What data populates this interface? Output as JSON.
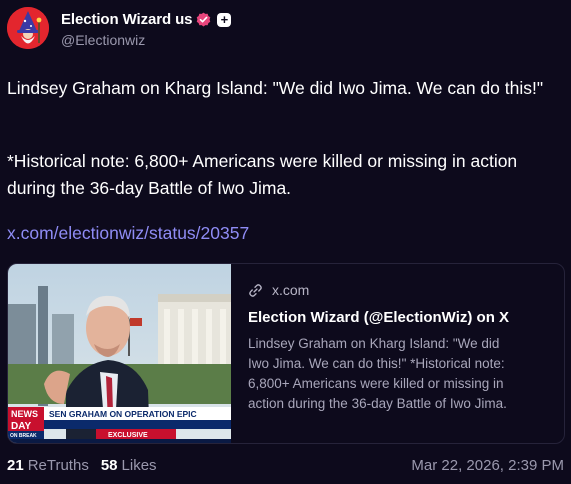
{
  "author": {
    "display_name": "Election Wizard us",
    "handle": "@Electionwiz",
    "follow_symbol": "+",
    "verified_color": "#e8457c",
    "avatar_color": "#e3262e"
  },
  "post": {
    "paragraph_1": "Lindsey Graham on Kharg Island: \"We did Iwo Jima. We can do this!\"",
    "paragraph_2": "*Historical note: 6,800+ Americans were killed or missing in action during the 36-day Battle of Iwo Jima.",
    "link_text": "x.com/electionwiz/status/20357",
    "link_color": "#8f8cf5"
  },
  "card": {
    "domain": "x.com",
    "title": "Election Wizard (@ElectionWiz) on X",
    "description": "Lindsey Graham on Kharg Island: \"We did Iwo Jima. We can do this!\" *Historical note: 6,800+ Americans were killed or missing in action during the 36-day Battle of Iwo Jima.",
    "thumbnail_chyron": "SEN GRAHAM ON OPERATION EPIC",
    "thumbnail_exclusive": "EXCLUSIVE",
    "thumbnail_news_top": "NEWS",
    "thumbnail_news_bottom": "DAY",
    "thumbnail_small_tag": "ON BREAK"
  },
  "footer": {
    "retruths_count": "21",
    "retruths_label": "ReTruths",
    "likes_count": "58",
    "likes_label": "Likes",
    "timestamp": "Mar 22, 2026, 2:39 PM"
  }
}
